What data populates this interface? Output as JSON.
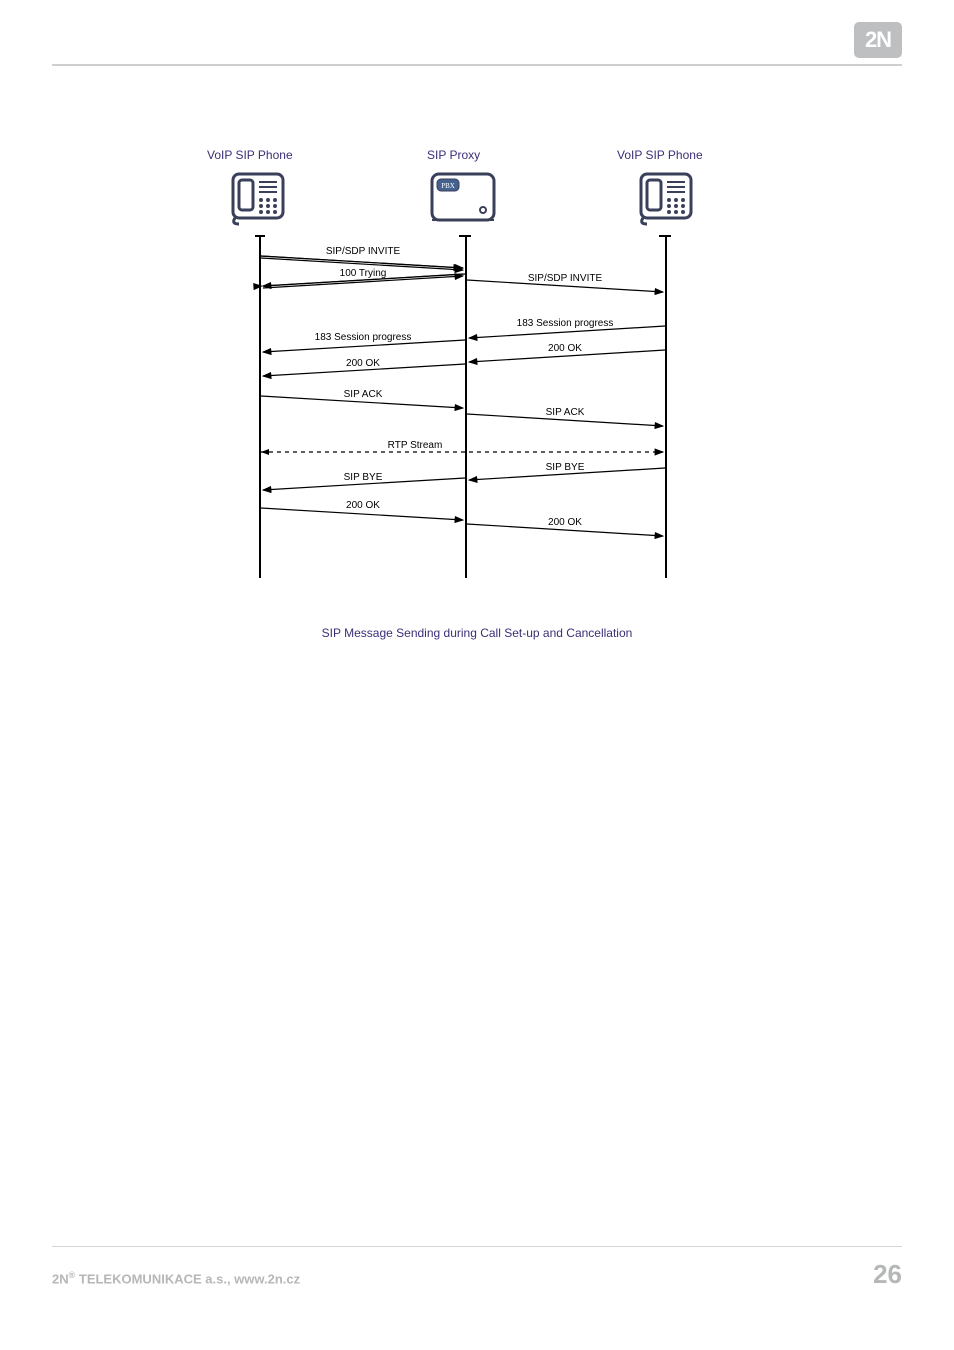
{
  "logo": "2N",
  "diagram": {
    "columns": {
      "left": "VoIP SIP Phone",
      "center": "SIP Proxy",
      "right": "VoIP SIP Phone"
    },
    "pbx_label": "PBX",
    "messages_left": [
      "SIP/SDP INVITE",
      "100 Trying",
      "183 Session progress",
      "200 OK",
      "SIP ACK",
      "RTP Stream",
      "SIP BYE",
      "200 OK"
    ],
    "messages_right": [
      "SIP/SDP INVITE",
      "183 Session progress",
      "200 OK",
      "SIP ACK",
      "SIP BYE",
      "200 OK"
    ],
    "caption": "SIP Message Sending during Call Set-up and Cancellation"
  },
  "footer": {
    "company_prefix": "2N",
    "company_reg": "®",
    "company_suffix": " TELEKOMUNIKACE a.s., www.2n.cz",
    "page_number": "26"
  }
}
